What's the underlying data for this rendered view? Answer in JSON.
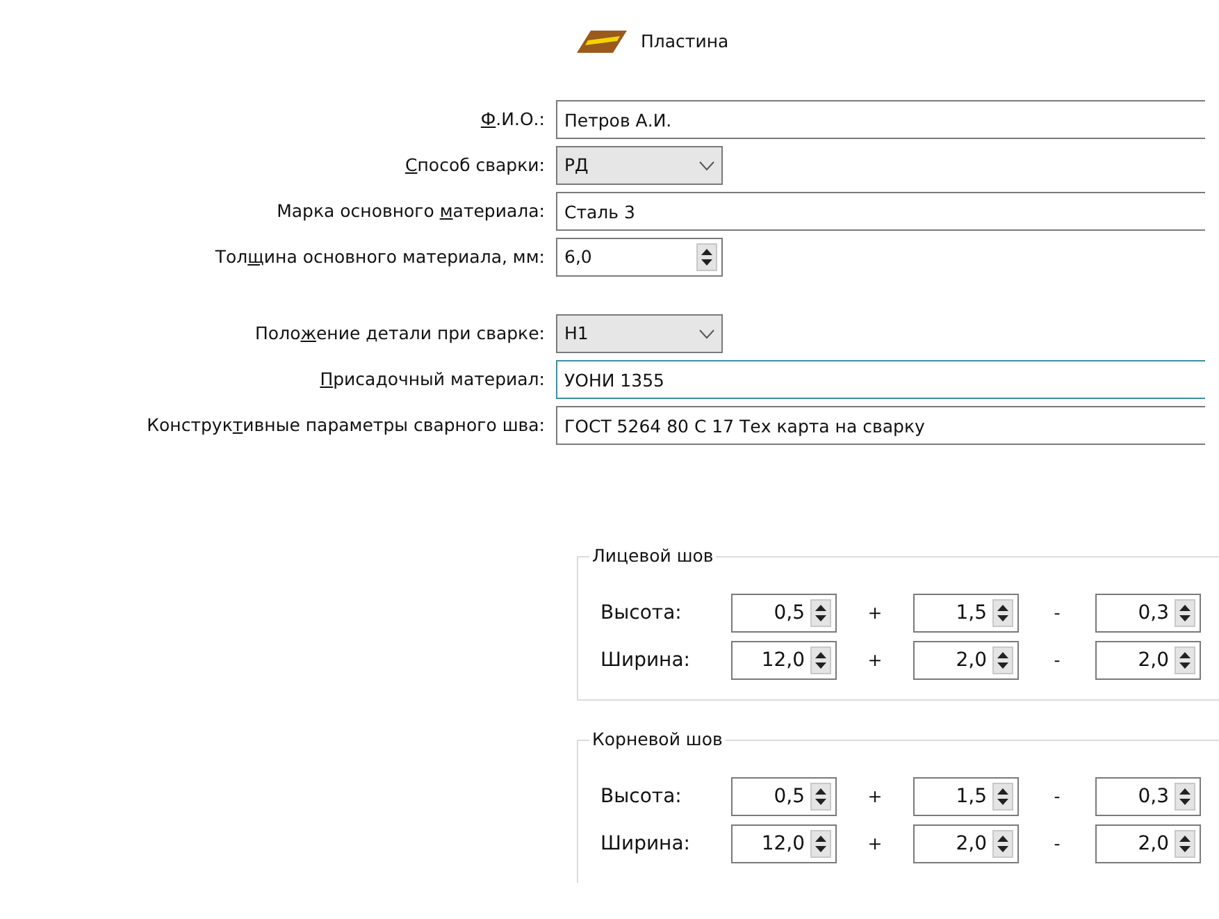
{
  "header": {
    "title": "Пластина"
  },
  "fields": [
    {
      "kind": "text",
      "label": [
        {
          "text": "Ф",
          "underline": true
        },
        {
          "text": ".И.О.:",
          "underline": false
        }
      ],
      "value": "Петров А.И.",
      "focused": false
    },
    {
      "kind": "combo",
      "label": [
        {
          "text": "С",
          "underline": true
        },
        {
          "text": "пособ сварки:",
          "underline": false
        }
      ],
      "value": "РД",
      "focused": false
    },
    {
      "kind": "text",
      "label": [
        {
          "text": "Марка основного ",
          "underline": false
        },
        {
          "text": "м",
          "underline": true
        },
        {
          "text": "атериала:",
          "underline": false
        }
      ],
      "value": "Сталь 3",
      "focused": false
    },
    {
      "kind": "spin",
      "label": [
        {
          "text": "Тол",
          "underline": false
        },
        {
          "text": "щ",
          "underline": true
        },
        {
          "text": "ина основного материала, мм:",
          "underline": false
        }
      ],
      "value": "6,0",
      "focused": false
    },
    {
      "kind": "combo",
      "label": [
        {
          "text": "Поло",
          "underline": false
        },
        {
          "text": "ж",
          "underline": true
        },
        {
          "text": "ение детали при сварке:",
          "underline": false
        }
      ],
      "value": "Н1",
      "focused": false
    },
    {
      "kind": "text",
      "label": [
        {
          "text": "П",
          "underline": true
        },
        {
          "text": "рисадочный материал:",
          "underline": false
        }
      ],
      "value": "УОНИ 1355",
      "focused": true
    },
    {
      "kind": "text",
      "label": [
        {
          "text": "Конструк",
          "underline": false
        },
        {
          "text": "т",
          "underline": true
        },
        {
          "text": "ивные параметры сварного шва:",
          "underline": false
        }
      ],
      "value": "ГОСТ 5264 80 С 17 Тех карта на сварку",
      "focused": false
    }
  ],
  "groups": [
    {
      "title": "Лицевой шов",
      "rows": [
        {
          "label": "Высота:",
          "value": "0,5",
          "plus_sign": "+",
          "plus": "1,5",
          "minus_sign": "-",
          "minus": "0,3"
        },
        {
          "label": "Ширина:",
          "value": "12,0",
          "plus_sign": "+",
          "plus": "2,0",
          "minus_sign": "-",
          "minus": "2,0"
        }
      ]
    },
    {
      "title": "Корневой шов",
      "rows": [
        {
          "label": "Высота:",
          "value": "0,5",
          "plus_sign": "+",
          "plus": "1,5",
          "minus_sign": "-",
          "minus": "0,3"
        },
        {
          "label": "Ширина:",
          "value": "12,0",
          "plus_sign": "+",
          "plus": "2,0",
          "minus_sign": "-",
          "minus": "2,0"
        }
      ]
    }
  ]
}
